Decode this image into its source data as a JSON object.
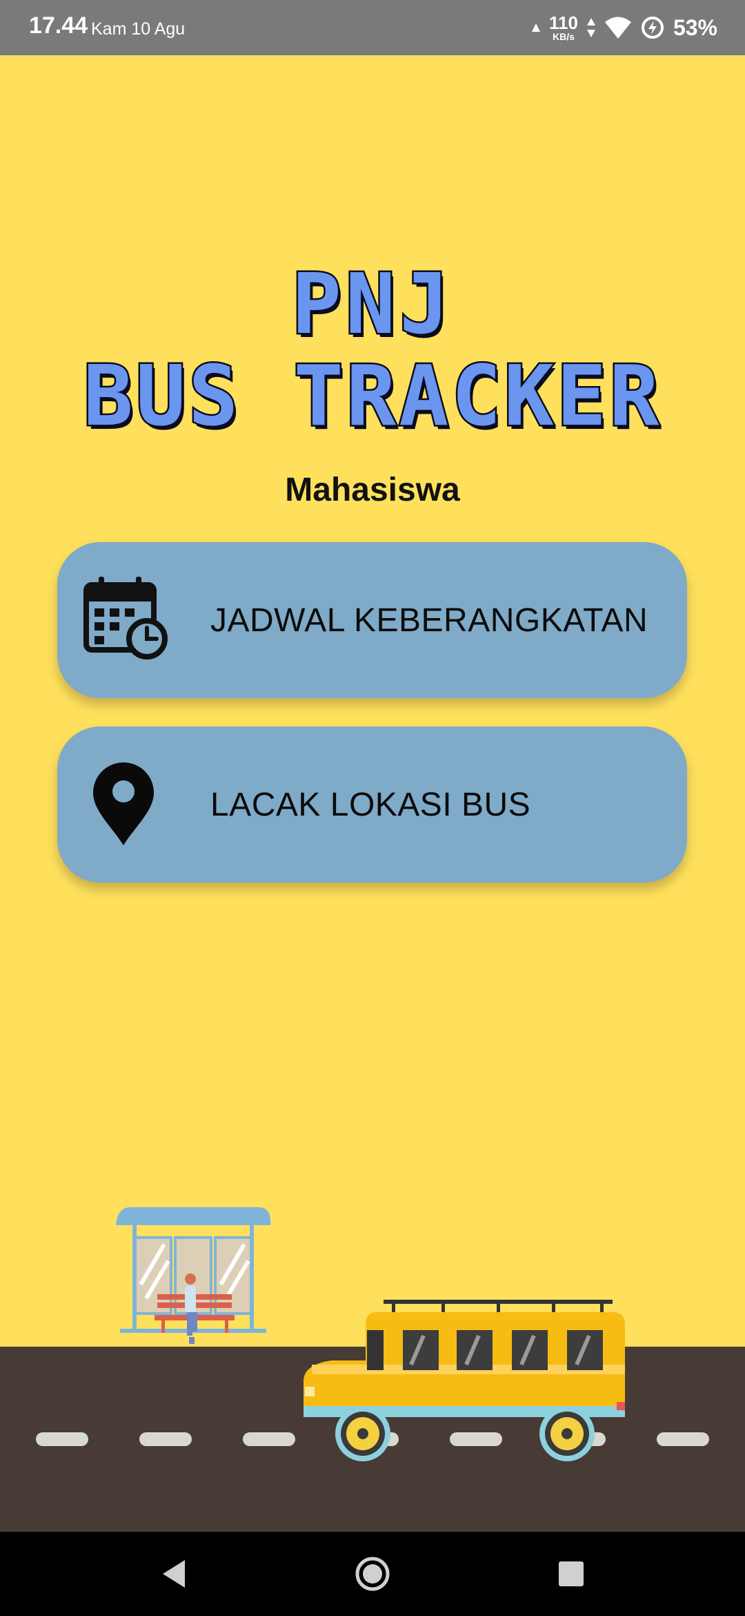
{
  "status_bar": {
    "time": "17.44",
    "date": "Kam 10 Agu",
    "network_speed": "110",
    "network_unit": "KB/s",
    "battery": "53%"
  },
  "header": {
    "title_line1": "PNJ",
    "title_line2": "BUS TRACKER",
    "role": "Mahasiswa"
  },
  "menu": {
    "schedule_label": "JADWAL KEBERANGKATAN",
    "schedule_icon": "calendar-clock-icon",
    "track_label": "LACAK LOKASI BUS",
    "track_icon": "map-pin-icon"
  },
  "colors": {
    "background": "#FFE05C",
    "button": "#7FAAC8",
    "title_fill": "#6A96F0",
    "road": "#483A35",
    "bus": "#F7BC12"
  }
}
